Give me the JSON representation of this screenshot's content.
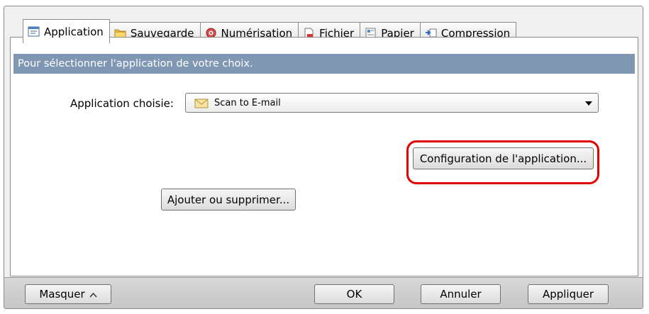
{
  "tabs": [
    {
      "label": "Application",
      "icon": "application-tab-icon",
      "active": true
    },
    {
      "label": "Sauvegarde",
      "icon": "folder-icon",
      "active": false
    },
    {
      "label": "Numérisation",
      "icon": "scan-settings-icon",
      "active": false
    },
    {
      "label": "Fichier",
      "icon": "file-icon",
      "active": false
    },
    {
      "label": "Papier",
      "icon": "paper-icon",
      "active": false
    },
    {
      "label": "Compression",
      "icon": "compression-icon",
      "active": false
    }
  ],
  "banner": "Pour sélectionner l'application de votre choix.",
  "application": {
    "label": "Application choisie:",
    "selected": "Scan to E-mail",
    "selected_icon": "envelope-icon"
  },
  "buttons": {
    "configure": "Configuration de l'application...",
    "add_remove": "Ajouter ou supprimer...",
    "hide": "Masquer",
    "ok": "OK",
    "cancel": "Annuler",
    "apply": "Appliquer"
  },
  "colors": {
    "banner": "#7f97b3",
    "highlight": "#e00000"
  }
}
